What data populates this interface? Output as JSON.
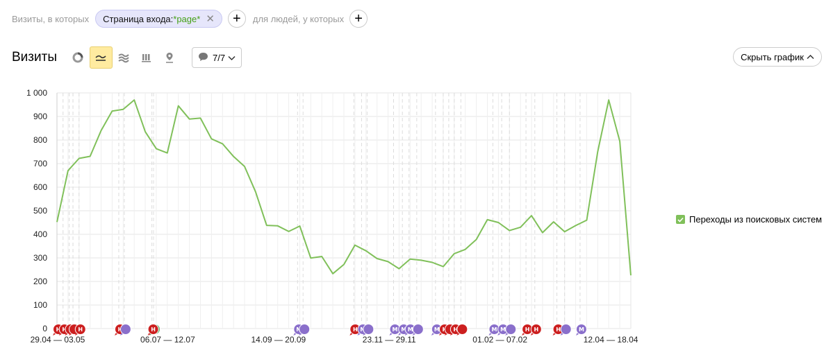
{
  "filter": {
    "visits_label": "Визиты, в которых",
    "chip_prefix": "Страница входа: ",
    "chip_value": "*page*",
    "people_label": "для людей, у которых",
    "add_symbol": "+"
  },
  "header": {
    "title": "Визиты",
    "annotations_value": "7/7",
    "hide_chart_label": "Скрыть график"
  },
  "legend": {
    "label": "Переходы из поисковых систем"
  },
  "colors": {
    "line": "#80c05a",
    "marker_red": "#cc1f1f",
    "marker_purple": "#8a6fcb",
    "marker_green": "#5aae6a"
  },
  "chart_data": {
    "type": "line",
    "x_tick_labels": [
      "29.04 — 03.05",
      "06.07 — 12.07",
      "14.09 — 20.09",
      "23.11 — 29.11",
      "01.02 — 07.02",
      "12.04 — 18.04"
    ],
    "ylim": [
      0,
      1000
    ],
    "y_ticks": [
      0,
      100,
      200,
      300,
      400,
      500,
      600,
      700,
      800,
      900,
      1000
    ],
    "y_tick_labels": [
      "0",
      "100",
      "200",
      "300",
      "400",
      "500",
      "600",
      "700",
      "800",
      "900",
      "1 000"
    ],
    "grid": true,
    "legend_position": "right",
    "series": [
      {
        "name": "Переходы из поисковых систем",
        "values": [
          452,
          670,
          722,
          731,
          840,
          923,
          930,
          970,
          835,
          763,
          745,
          945,
          889,
          893,
          805,
          784,
          730,
          688,
          580,
          438,
          436,
          412,
          435,
          299,
          306,
          233,
          272,
          354,
          330,
          297,
          284,
          254,
          295,
          290,
          281,
          263,
          318,
          336,
          378,
          462,
          450,
          416,
          430,
          479,
          407,
          453,
          411,
          437,
          460,
          750,
          970,
          795,
          226
        ]
      }
    ],
    "annotation_markers": [
      {
        "index": 0.0,
        "label": "Н",
        "color": "red"
      },
      {
        "index": 0.55,
        "label": "Н",
        "color": "red"
      },
      {
        "index": 1.1,
        "label": "",
        "color": "red"
      },
      {
        "index": 1.45,
        "label": "",
        "color": "red"
      },
      {
        "index": 2.0,
        "label": "Н",
        "color": "red"
      },
      {
        "index": 5.6,
        "label": "Н",
        "color": "red"
      },
      {
        "index": 6.1,
        "label": "",
        "color": "purple"
      },
      {
        "index": 8.75,
        "label": "",
        "color": "green"
      },
      {
        "index": 8.6,
        "label": "Н",
        "color": "red"
      },
      {
        "index": 21.8,
        "label": "М",
        "color": "purple"
      },
      {
        "index": 22.3,
        "label": "",
        "color": "purple"
      },
      {
        "index": 26.9,
        "label": "Н",
        "color": "red"
      },
      {
        "index": 27.6,
        "label": "М",
        "color": "purple"
      },
      {
        "index": 28.1,
        "label": "",
        "color": "purple"
      },
      {
        "index": 30.5,
        "label": "М",
        "color": "purple"
      },
      {
        "index": 31.3,
        "label": "М",
        "color": "purple"
      },
      {
        "index": 31.9,
        "label": "М",
        "color": "purple"
      },
      {
        "index": 32.6,
        "label": "",
        "color": "purple"
      },
      {
        "index": 34.3,
        "label": "М",
        "color": "purple"
      },
      {
        "index": 35.0,
        "label": "Н",
        "color": "red"
      },
      {
        "index": 35.5,
        "label": "",
        "color": "red"
      },
      {
        "index": 36.0,
        "label": "Н",
        "color": "red"
      },
      {
        "index": 36.6,
        "label": "",
        "color": "red"
      },
      {
        "index": 39.5,
        "label": "М",
        "color": "purple"
      },
      {
        "index": 40.3,
        "label": "М",
        "color": "purple"
      },
      {
        "index": 41.0,
        "label": "",
        "color": "purple"
      },
      {
        "index": 42.5,
        "label": "Н",
        "color": "red"
      },
      {
        "index": 43.3,
        "label": "Н",
        "color": "red"
      },
      {
        "index": 45.3,
        "label": "Н",
        "color": "red"
      },
      {
        "index": 46.0,
        "label": "",
        "color": "purple"
      },
      {
        "index": 47.4,
        "label": "М",
        "color": "purple"
      }
    ]
  }
}
